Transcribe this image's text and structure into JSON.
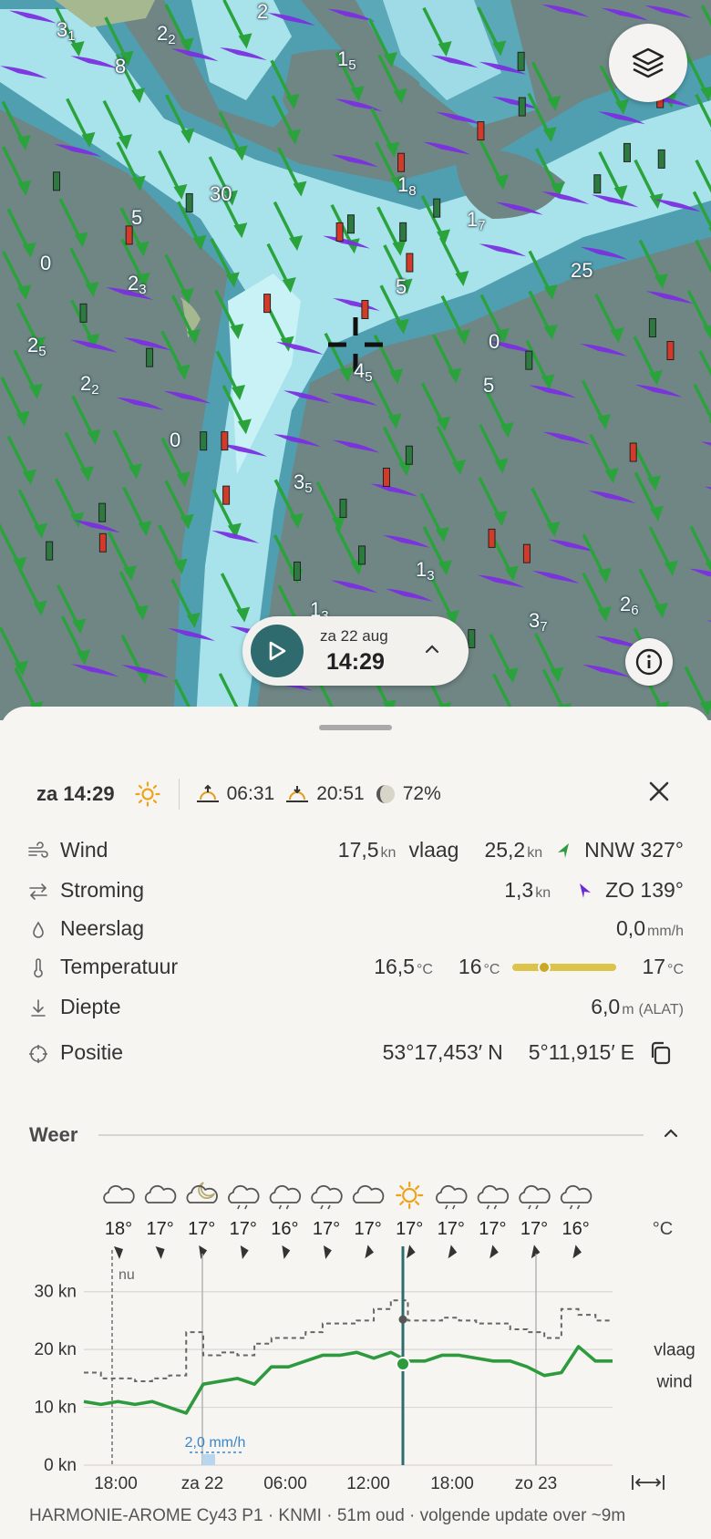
{
  "map": {
    "depth_labels": [
      {
        "main": "3",
        "sub": "1"
      },
      {
        "main": "2",
        "sub": "2"
      },
      {
        "main": "1",
        "sub": "5"
      },
      {
        "main": "1",
        "sub": "8"
      },
      {
        "main": "1",
        "sub": "7"
      },
      {
        "main": "2",
        "sub": "3"
      },
      {
        "main": "2",
        "sub": "5"
      },
      {
        "main": "2",
        "sub": "2"
      },
      {
        "main": "4",
        "sub": "5"
      },
      {
        "main": "3",
        "sub": "5"
      },
      {
        "main": "1",
        "sub": "3"
      },
      {
        "main": "3",
        "sub": "7"
      },
      {
        "main": "2",
        "sub": "6"
      },
      {
        "main": "1",
        "sub": "3"
      },
      {
        "main": "0",
        "sub": ""
      },
      {
        "main": "5",
        "sub": ""
      },
      {
        "main": "5",
        "sub": ""
      },
      {
        "main": "0",
        "sub": ""
      },
      {
        "main": "8",
        "sub": ""
      },
      {
        "main": "5",
        "sub": ""
      },
      {
        "main": "0",
        "sub": ""
      },
      {
        "main": "2",
        "sub": ""
      },
      {
        "main": "30",
        "sub": ""
      },
      {
        "main": "25",
        "sub": ""
      }
    ],
    "time_control": {
      "date": "za 22 aug",
      "time": "14:29"
    }
  },
  "summary": {
    "day_time": "za 14:29",
    "sunrise": "06:31",
    "sunset": "20:51",
    "moon_pct": "72%"
  },
  "rows": {
    "wind": {
      "label": "Wind",
      "speed": "17,5",
      "unit": "kn",
      "gust_label": "vlaag",
      "gust": "25,2",
      "gust_unit": "kn",
      "dir": "NNW 327°",
      "arrow_color": "#2e9a3e"
    },
    "current": {
      "label": "Stroming",
      "speed": "1,3",
      "unit": "kn",
      "dir": "ZO 139°",
      "arrow_color": "#6a2bd9"
    },
    "rain": {
      "label": "Neerslag",
      "value": "0,0",
      "unit": "mm/h"
    },
    "temp": {
      "label": "Temperatuur",
      "value": "16,5",
      "unit": "°C",
      "min": "16",
      "max": "17",
      "range_unit": "°C",
      "bar_color": "#dcc34a"
    },
    "depth": {
      "label": "Diepte",
      "value": "6,0",
      "unit": "m",
      "ref": "(ALAT)"
    },
    "position": {
      "label": "Positie",
      "lat": "53°17,453′",
      "lat_hemi": "N",
      "lon": "5°11,915′",
      "lon_hemi": "E"
    }
  },
  "weather": {
    "title": "Weer",
    "temp_unit": "°C",
    "icons": [
      "cloud",
      "cloud",
      "cloud-moon",
      "cloud-rain",
      "cloud-rain",
      "cloud-rain",
      "cloud",
      "sun",
      "cloud-rain",
      "cloud-rain",
      "cloud-rain",
      "cloud-rain"
    ],
    "temps": [
      "18°",
      "17°",
      "17°",
      "17°",
      "16°",
      "17°",
      "17°",
      "17°",
      "17°",
      "17°",
      "17°",
      "16°"
    ]
  },
  "chart_data": {
    "type": "line",
    "y_ticks": [
      "30 kn",
      "20 kn",
      "10 kn",
      "0 kn"
    ],
    "ylim": [
      0,
      35
    ],
    "x_ticks": [
      "18:00",
      "za 22",
      "06:00",
      "12:00",
      "18:00",
      "zo 23"
    ],
    "now_label": "nu",
    "rain_label": "2,0 mm/h",
    "series": [
      {
        "name": "vlaag",
        "style": "dashed",
        "color": "#666666",
        "values": [
          16,
          15,
          15,
          14.5,
          15,
          15.5,
          23,
          19,
          19.5,
          19,
          21,
          22,
          22,
          23,
          24.5,
          24.5,
          25,
          27,
          28.5,
          25,
          25,
          25.5,
          25,
          24.5,
          24.5,
          23.5,
          23,
          22,
          27,
          26,
          25,
          25
        ]
      },
      {
        "name": "wind",
        "style": "solid",
        "color": "#2e9a3e",
        "values": [
          11,
          10.5,
          11,
          10.5,
          11,
          10,
          9,
          14,
          14.5,
          15,
          14,
          17,
          17,
          18,
          19,
          19,
          19.5,
          18.5,
          19.5,
          18,
          18,
          19,
          19,
          18.5,
          18,
          18,
          17,
          15.5,
          16,
          20.5,
          18,
          18
        ]
      }
    ],
    "current_value": {
      "vlaag": 25.2,
      "wind": 17.5
    }
  },
  "footer": "HARMONIE-AROME Cy43 P1 · KNMI · 51m oud · volgende update over ~9m"
}
